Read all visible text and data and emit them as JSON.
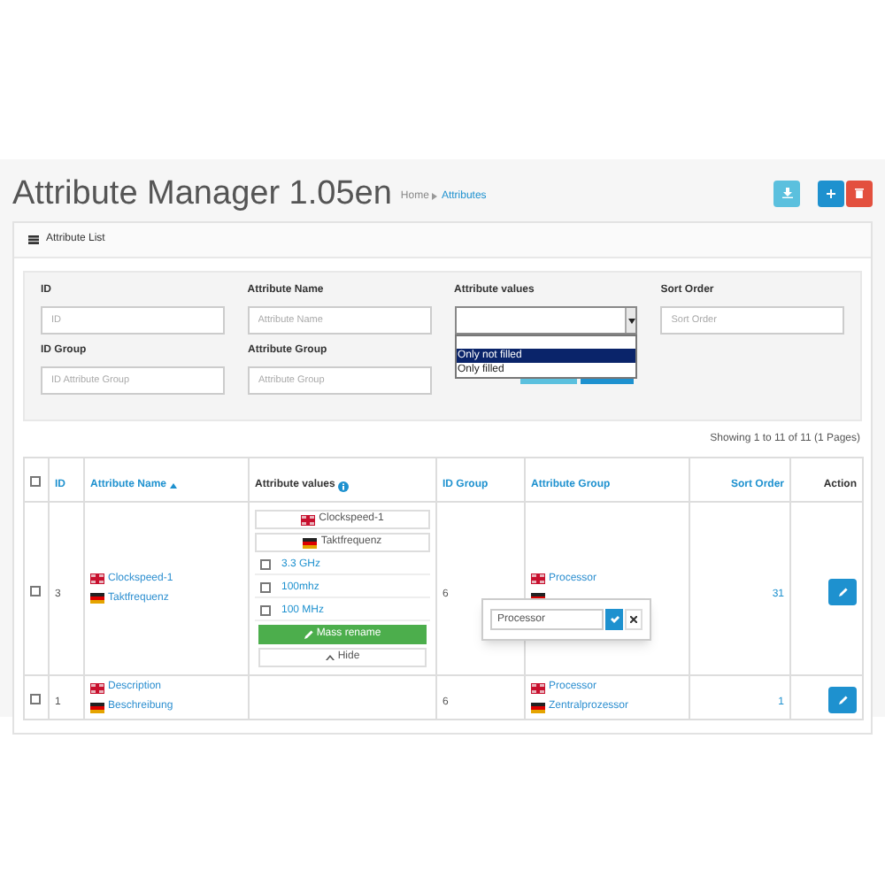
{
  "header": {
    "title": "Attribute Manager 1.05en",
    "breadcrumbs": [
      {
        "label": "Home",
        "current": false
      },
      {
        "label": "Attributes",
        "current": true
      }
    ]
  },
  "toolbar": [
    {
      "kind": "download"
    },
    {
      "kind": "add"
    },
    {
      "kind": "delete"
    }
  ],
  "panel": {
    "title": "Attribute List"
  },
  "filters": [
    {
      "label": "ID",
      "kind": "input",
      "placeholder": "ID"
    },
    {
      "label": "Attribute Name",
      "kind": "input",
      "placeholder": "Attribute Name"
    },
    {
      "label": "Attribute values",
      "kind": "select",
      "expanded": true,
      "options": [
        {
          "label": "Only not filled",
          "selected": true
        },
        {
          "label": "Only filled",
          "selected": false
        }
      ]
    },
    {
      "label": "Sort Order",
      "kind": "input",
      "placeholder": "Sort Order"
    },
    {
      "label": "ID Group",
      "kind": "input",
      "placeholder": "ID Attribute Group"
    },
    {
      "label": "Attribute Group",
      "kind": "input",
      "placeholder": "Attribute Group"
    }
  ],
  "pagination_summary": "Showing 1 to 11 of 11 (1 Pages)",
  "table": {
    "select_all_checked": false,
    "columns": [
      {
        "kind": "checkbox"
      },
      {
        "kind": "text",
        "label": "ID",
        "sortable": true,
        "sorted": false
      },
      {
        "kind": "text",
        "label": "Attribute Name",
        "sortable": true,
        "sorted": true
      },
      {
        "kind": "info",
        "label": "Attribute values",
        "sortable": false,
        "sorted": false
      },
      {
        "kind": "text",
        "label": "ID Group",
        "sortable": true,
        "sorted": false
      },
      {
        "kind": "text",
        "label": "Attribute Group",
        "sortable": true,
        "sorted": false
      },
      {
        "kind": "number",
        "label": "Sort Order",
        "sortable": true,
        "sorted": false
      },
      {
        "kind": "action",
        "label": "Action",
        "sortable": false,
        "sorted": false
      }
    ],
    "rows": [
      {
        "checked": false,
        "id": "3",
        "names": [
          {
            "kind": "english",
            "text": "Clockspeed-1"
          },
          {
            "kind": "german",
            "text": "Taktfrequenz"
          }
        ],
        "values": {
          "expanded": true,
          "names": [
            {
              "kind": "english",
              "text": "Clockspeed-1"
            },
            {
              "kind": "german",
              "text": "Taktfrequenz"
            }
          ],
          "items": [
            {
              "label": "3.3 GHz",
              "checked": false
            },
            {
              "label": "100mhz",
              "checked": false
            },
            {
              "label": "100 MHz",
              "checked": false
            }
          ],
          "mass_rename": "Mass rename",
          "hide": "Hide"
        },
        "id_group": "6",
        "groups": [
          {
            "kind": "english",
            "text": "Processor"
          },
          {
            "kind": "german"
          }
        ],
        "sort_order": "31",
        "inline_edit": {
          "value": "Processor"
        }
      },
      {
        "checked": false,
        "id": "1",
        "names": [
          {
            "kind": "english",
            "text": "Description"
          },
          {
            "kind": "german",
            "text": "Beschreibung"
          }
        ],
        "values": {
          "expanded": false
        },
        "id_group": "6",
        "groups": [
          {
            "kind": "english",
            "text": "Processor"
          },
          {
            "kind": "german",
            "text": "Zentralprozessor"
          }
        ],
        "sort_order": "1"
      }
    ]
  }
}
